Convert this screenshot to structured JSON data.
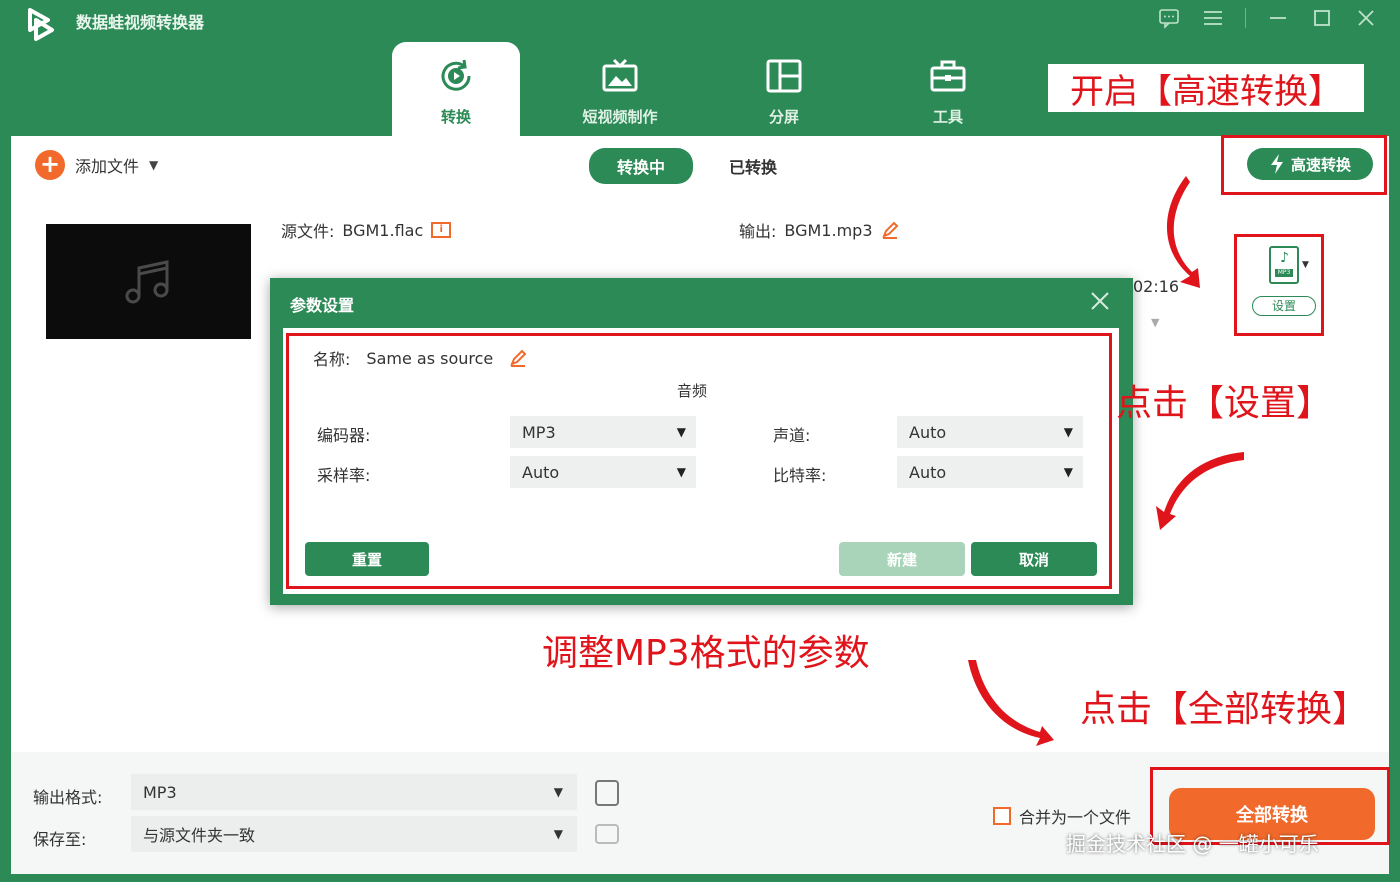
{
  "app": {
    "title": "数据蛙视频转换器"
  },
  "nav": {
    "tabs": [
      {
        "label": "转换"
      },
      {
        "label": "短视频制作"
      },
      {
        "label": "分屏"
      },
      {
        "label": "工具"
      }
    ]
  },
  "toolbar": {
    "add_file": "添加文件",
    "tab_converting": "转换中",
    "tab_converted": "已转换",
    "high_speed": "高速转换"
  },
  "file": {
    "source_label": "源文件:",
    "source_name": "BGM1.flac",
    "output_label": "输出:",
    "output_name": "BGM1.mp3",
    "duration": "02:16",
    "format_badge": "MP3",
    "settings_btn": "设置"
  },
  "dialog": {
    "title": "参数设置",
    "name_label": "名称:",
    "name_value": "Same as source",
    "section": "音频",
    "encoder_label": "编码器:",
    "encoder_value": "MP3",
    "channel_label": "声道:",
    "channel_value": "Auto",
    "samplerate_label": "采样率:",
    "samplerate_value": "Auto",
    "bitrate_label": "比特率:",
    "bitrate_value": "Auto",
    "reset": "重置",
    "create": "新建",
    "cancel": "取消"
  },
  "bottom": {
    "format_label": "输出格式:",
    "format_value": "MP3",
    "save_label": "保存至:",
    "save_value": "与源文件夹一致",
    "merge": "合并为一个文件",
    "convert_all": "全部转换"
  },
  "annotations": {
    "enable_label": "开启【高速转换】",
    "click_settings": "点击【设置】",
    "adjust": "调整MP3格式的参数",
    "click_convert_all": "点击【全部转换】",
    "watermark": "掘金技术社区 @ 一罐小可乐"
  },
  "colors": {
    "primary": "#2b8a56",
    "accent": "#f16a2b",
    "annotation": "#e0141b"
  }
}
